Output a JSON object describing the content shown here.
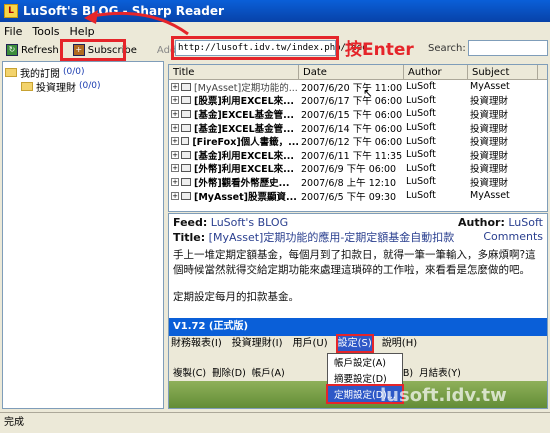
{
  "window": {
    "title": "LuSoft's BLOG - Sharp Reader"
  },
  "menu": [
    "File",
    "Tools",
    "Help"
  ],
  "toolbar": {
    "refresh": "Refresh",
    "subscribe": "Subscribe",
    "address_label": "Address",
    "address_value": "http://lusoft.idv.tw/index.php/feed",
    "search_label": "Search:"
  },
  "annotation": "按Enter",
  "tree": [
    {
      "label": "我的訂閱",
      "count": "(0/0)"
    },
    {
      "label": "投資理財",
      "count": "(0/0)"
    }
  ],
  "list": {
    "headers": [
      "Title",
      "Date",
      "Author",
      "Subject"
    ],
    "rows": [
      {
        "title": "[MyAsset]定期功能的...",
        "date": "2007/6/20 下午 11:00",
        "author": "LuSoft",
        "subject": "MyAsset",
        "read": true
      },
      {
        "title": "[股票]利用EXCEL來...",
        "date": "2007/6/17 下午 06:00",
        "author": "LuSoft",
        "subject": "投資理財",
        "read": false
      },
      {
        "title": "[基金]EXCEL基金管...",
        "date": "2007/6/15 下午 06:00",
        "author": "LuSoft",
        "subject": "投資理財",
        "read": false
      },
      {
        "title": "[基金]EXCEL基金管...",
        "date": "2007/6/14 下午 06:00",
        "author": "LuSoft",
        "subject": "投資理財",
        "read": false
      },
      {
        "title": "[FireFox]個人書籤，...",
        "date": "2007/6/12 下午 06:00",
        "author": "LuSoft",
        "subject": "投資理財",
        "read": false
      },
      {
        "title": "[基金]利用EXCEL來...",
        "date": "2007/6/11 下午 11:35",
        "author": "LuSoft",
        "subject": "投資理財",
        "read": false
      },
      {
        "title": "[外幣]利用EXCEL來...",
        "date": "2007/6/9 下午 06:00",
        "author": "LuSoft",
        "subject": "投資理財",
        "read": false
      },
      {
        "title": "[外幣]觀看外幣歷史...",
        "date": "2007/6/8 上午 12:10",
        "author": "LuSoft",
        "subject": "投資理財",
        "read": false
      },
      {
        "title": "[MyAsset]股票顯資...",
        "date": "2007/6/5 下午 09:30",
        "author": "LuSoft",
        "subject": "MyAsset",
        "read": false
      }
    ]
  },
  "feed": {
    "feed_label": "Feed:",
    "feed_name": "LuSoft's BLOG",
    "author_label": "Author:",
    "author_name": "LuSoft",
    "title_label": "Title:",
    "title_text": "[MyAsset]定期功能的應用-定期定額基金自動扣款",
    "comments": "Comments",
    "paragraph1": "手上一堆定期定額基金，每個月到了扣款日，就得一筆一筆輸入，多麻煩啊?這個時候當然就得交給定期功能來處理這瑣碎的工作啦，來看看是怎麼做的吧。",
    "paragraph2": "定期設定每月的扣款基金。"
  },
  "embed": {
    "titlebar": "V1.72 (正式版)",
    "menu": [
      "財務報表(I)",
      "投資理財(I)",
      "用戶(U)",
      "設定(S)",
      "說明(H)"
    ],
    "tools": [
      "複製(C)",
      "刪除(D)",
      "帳戶(A)",
      "資債表(B)",
      "月結表(Y)"
    ],
    "popup": [
      "帳戶設定(A)",
      "摘要設定(D)",
      "定期設定(D)..."
    ],
    "watermark": "lusoft.idv.tw"
  },
  "status": "完成"
}
